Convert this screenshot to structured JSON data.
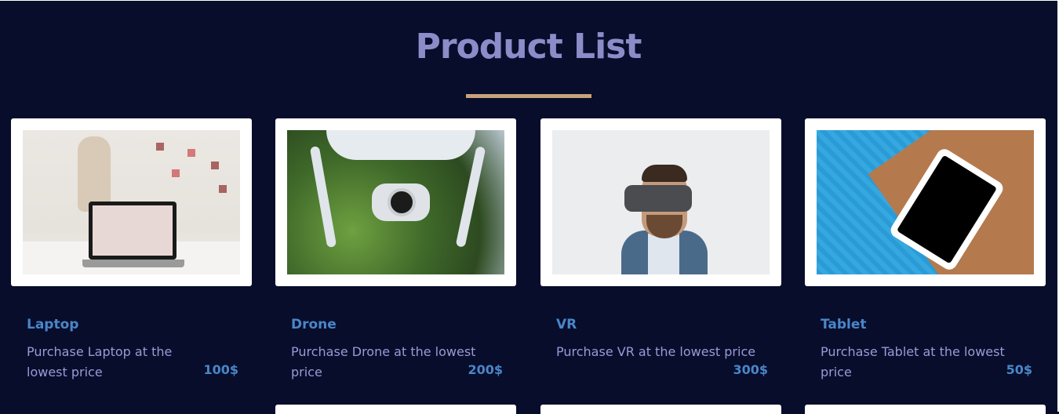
{
  "page": {
    "title": "Product List",
    "accent_color": "#c9a27a",
    "title_color": "#8c8cc9",
    "background": "#070d2b"
  },
  "products": [
    {
      "name": "Laptop",
      "description": "Purchase Laptop at the lowest price",
      "price": "100$",
      "image": "laptop-photo"
    },
    {
      "name": "Drone",
      "description": "Purchase Drone at the lowest price",
      "price": "200$",
      "image": "drone-photo"
    },
    {
      "name": "VR",
      "description": "Purchase VR at the lowest price",
      "price": "300$",
      "image": "vr-headset-photo"
    },
    {
      "name": "Tablet",
      "description": "Purchase Tablet at the lowest price",
      "price": "50$",
      "image": "tablet-photo"
    }
  ]
}
